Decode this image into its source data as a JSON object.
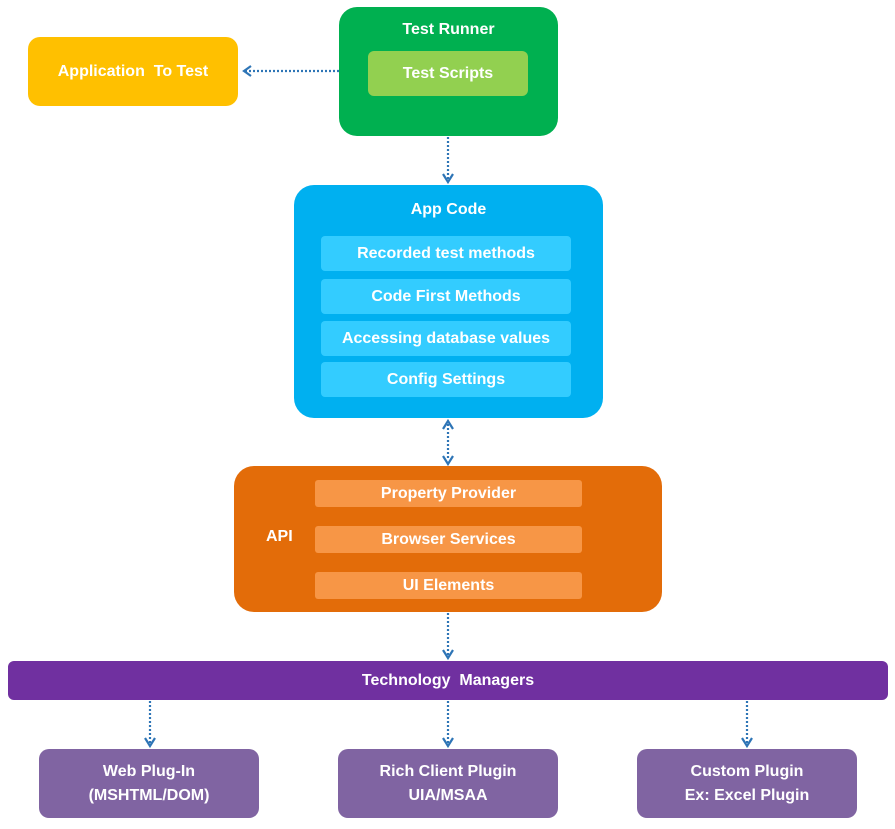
{
  "diagram": {
    "application_to_test": "Application  To Test",
    "test_runner": {
      "title": "Test Runner",
      "inner": "Test Scripts"
    },
    "app_code": {
      "title": "App Code",
      "items": [
        "Recorded test methods",
        "Code First Methods",
        "Accessing database values",
        "Config Settings"
      ]
    },
    "api": {
      "label": "API",
      "items": [
        "Property Provider",
        "Browser Services",
        "UI Elements"
      ]
    },
    "technology_managers": "Technology  Managers",
    "plugins": [
      {
        "line1": "Web Plug-In",
        "line2": "(MSHTML/DOM)"
      },
      {
        "line1": "Rich Client Plugin",
        "line2": "UIA/MSAA"
      },
      {
        "line1": "Custom Plugin",
        "line2": "Ex: Excel Plugin"
      }
    ],
    "colors": {
      "application": "#FFC000",
      "test_runner": "#00B050",
      "test_scripts": "#92D050",
      "app_code": "#00B0F0",
      "app_code_item": "#33CCFF",
      "api": "#E36C09",
      "api_item": "#F79646",
      "tech_managers": "#7030A0",
      "plugin": "#8064A2",
      "connector": "#2E75B6"
    },
    "connectors": [
      {
        "from": "test_runner",
        "to": "application_to_test",
        "style": "dotted",
        "arrow": "end"
      },
      {
        "from": "test_runner",
        "to": "app_code",
        "style": "dotted",
        "arrow": "end"
      },
      {
        "from": "app_code",
        "to": "api",
        "style": "dotted",
        "arrow": "both"
      },
      {
        "from": "api",
        "to": "technology_managers",
        "style": "dotted",
        "arrow": "end"
      },
      {
        "from": "technology_managers",
        "to": "web_plugin",
        "style": "dotted",
        "arrow": "end"
      },
      {
        "from": "technology_managers",
        "to": "rich_client_plugin",
        "style": "dotted",
        "arrow": "end"
      },
      {
        "from": "technology_managers",
        "to": "custom_plugin",
        "style": "dotted",
        "arrow": "end"
      }
    ]
  }
}
